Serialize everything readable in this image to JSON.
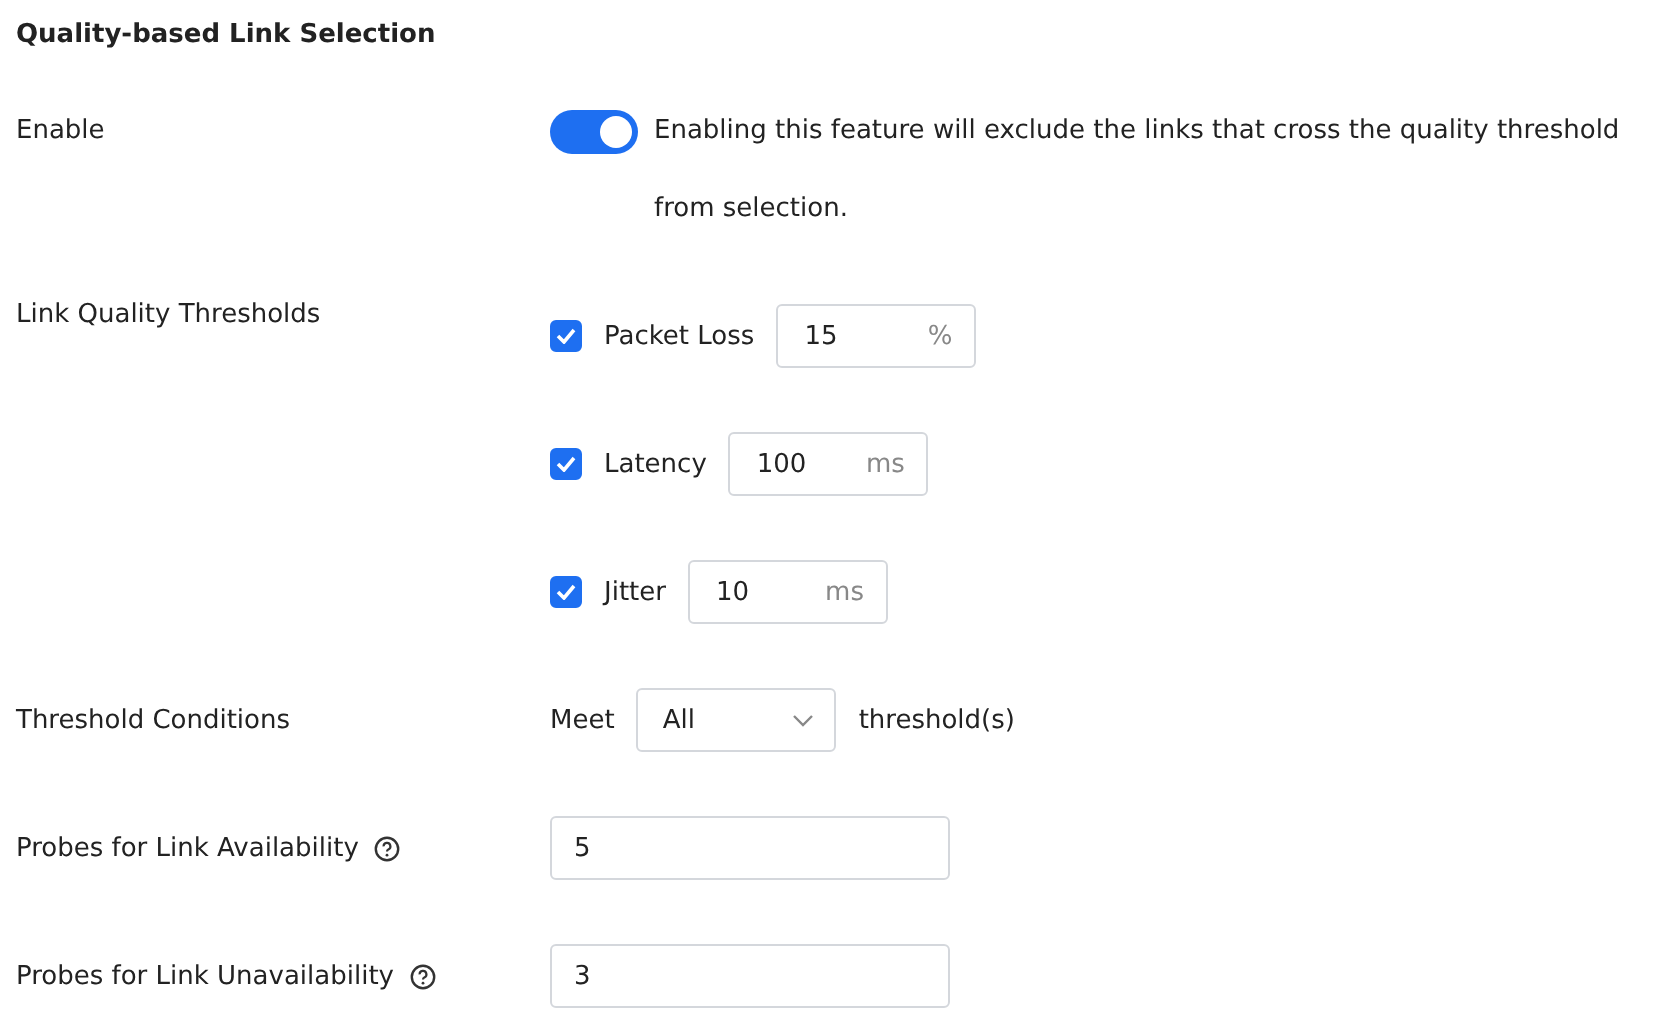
{
  "section_title": "Quality-based Link Selection",
  "enable": {
    "label": "Enable",
    "on": true,
    "description": "Enabling this feature will exclude the links that cross the quality threshold from selection."
  },
  "thresholds": {
    "label": "Link Quality Thresholds",
    "items": [
      {
        "label": "Packet Loss",
        "checked": true,
        "value": "15",
        "unit": "%"
      },
      {
        "label": "Latency",
        "checked": true,
        "value": "100",
        "unit": "ms"
      },
      {
        "label": "Jitter",
        "checked": true,
        "value": "10",
        "unit": "ms"
      }
    ]
  },
  "conditions": {
    "label": "Threshold Conditions",
    "prefix": "Meet",
    "value": "All",
    "suffix": "threshold(s)"
  },
  "probes": [
    {
      "label": "Probes for Link Availability",
      "value": "5"
    },
    {
      "label": "Probes for Link Unavailability",
      "value": "3"
    }
  ]
}
